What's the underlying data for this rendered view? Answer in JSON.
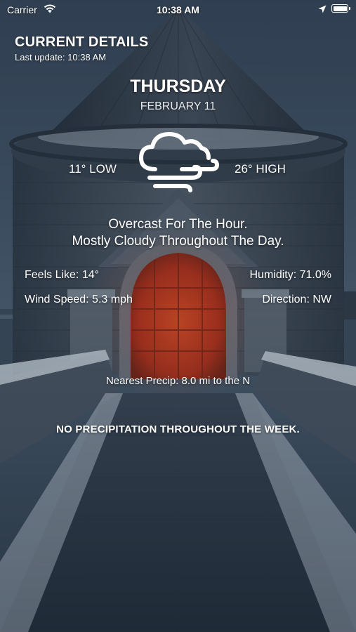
{
  "status_bar": {
    "carrier": "Carrier",
    "time": "10:38 AM"
  },
  "header": {
    "title": "CURRENT DETAILS",
    "last_update": "Last update: 10:38 AM"
  },
  "day": {
    "name": "THURSDAY",
    "date": "FEBRUARY 11"
  },
  "temps": {
    "low": "11° LOW",
    "high": "26° HIGH"
  },
  "icon": "cloudy-windy-icon",
  "summary": {
    "hour": "Overcast For The Hour.",
    "day": "Mostly Cloudy Throughout The Day."
  },
  "details": {
    "feels_like": "Feels Like: 14°",
    "humidity": "Humidity: 71.0%",
    "wind_speed": "Wind Speed: 5.3 mph",
    "direction": "Direction: NW"
  },
  "nearest_precip": "Nearest Precip: 8.0 mi to the N",
  "week_summary": "NO PRECIPITATION THROUGHOUT THE WEEK.",
  "colors": {
    "door": "#b8321a",
    "sky": "#3a4b5e",
    "stone": "#4c5968"
  }
}
